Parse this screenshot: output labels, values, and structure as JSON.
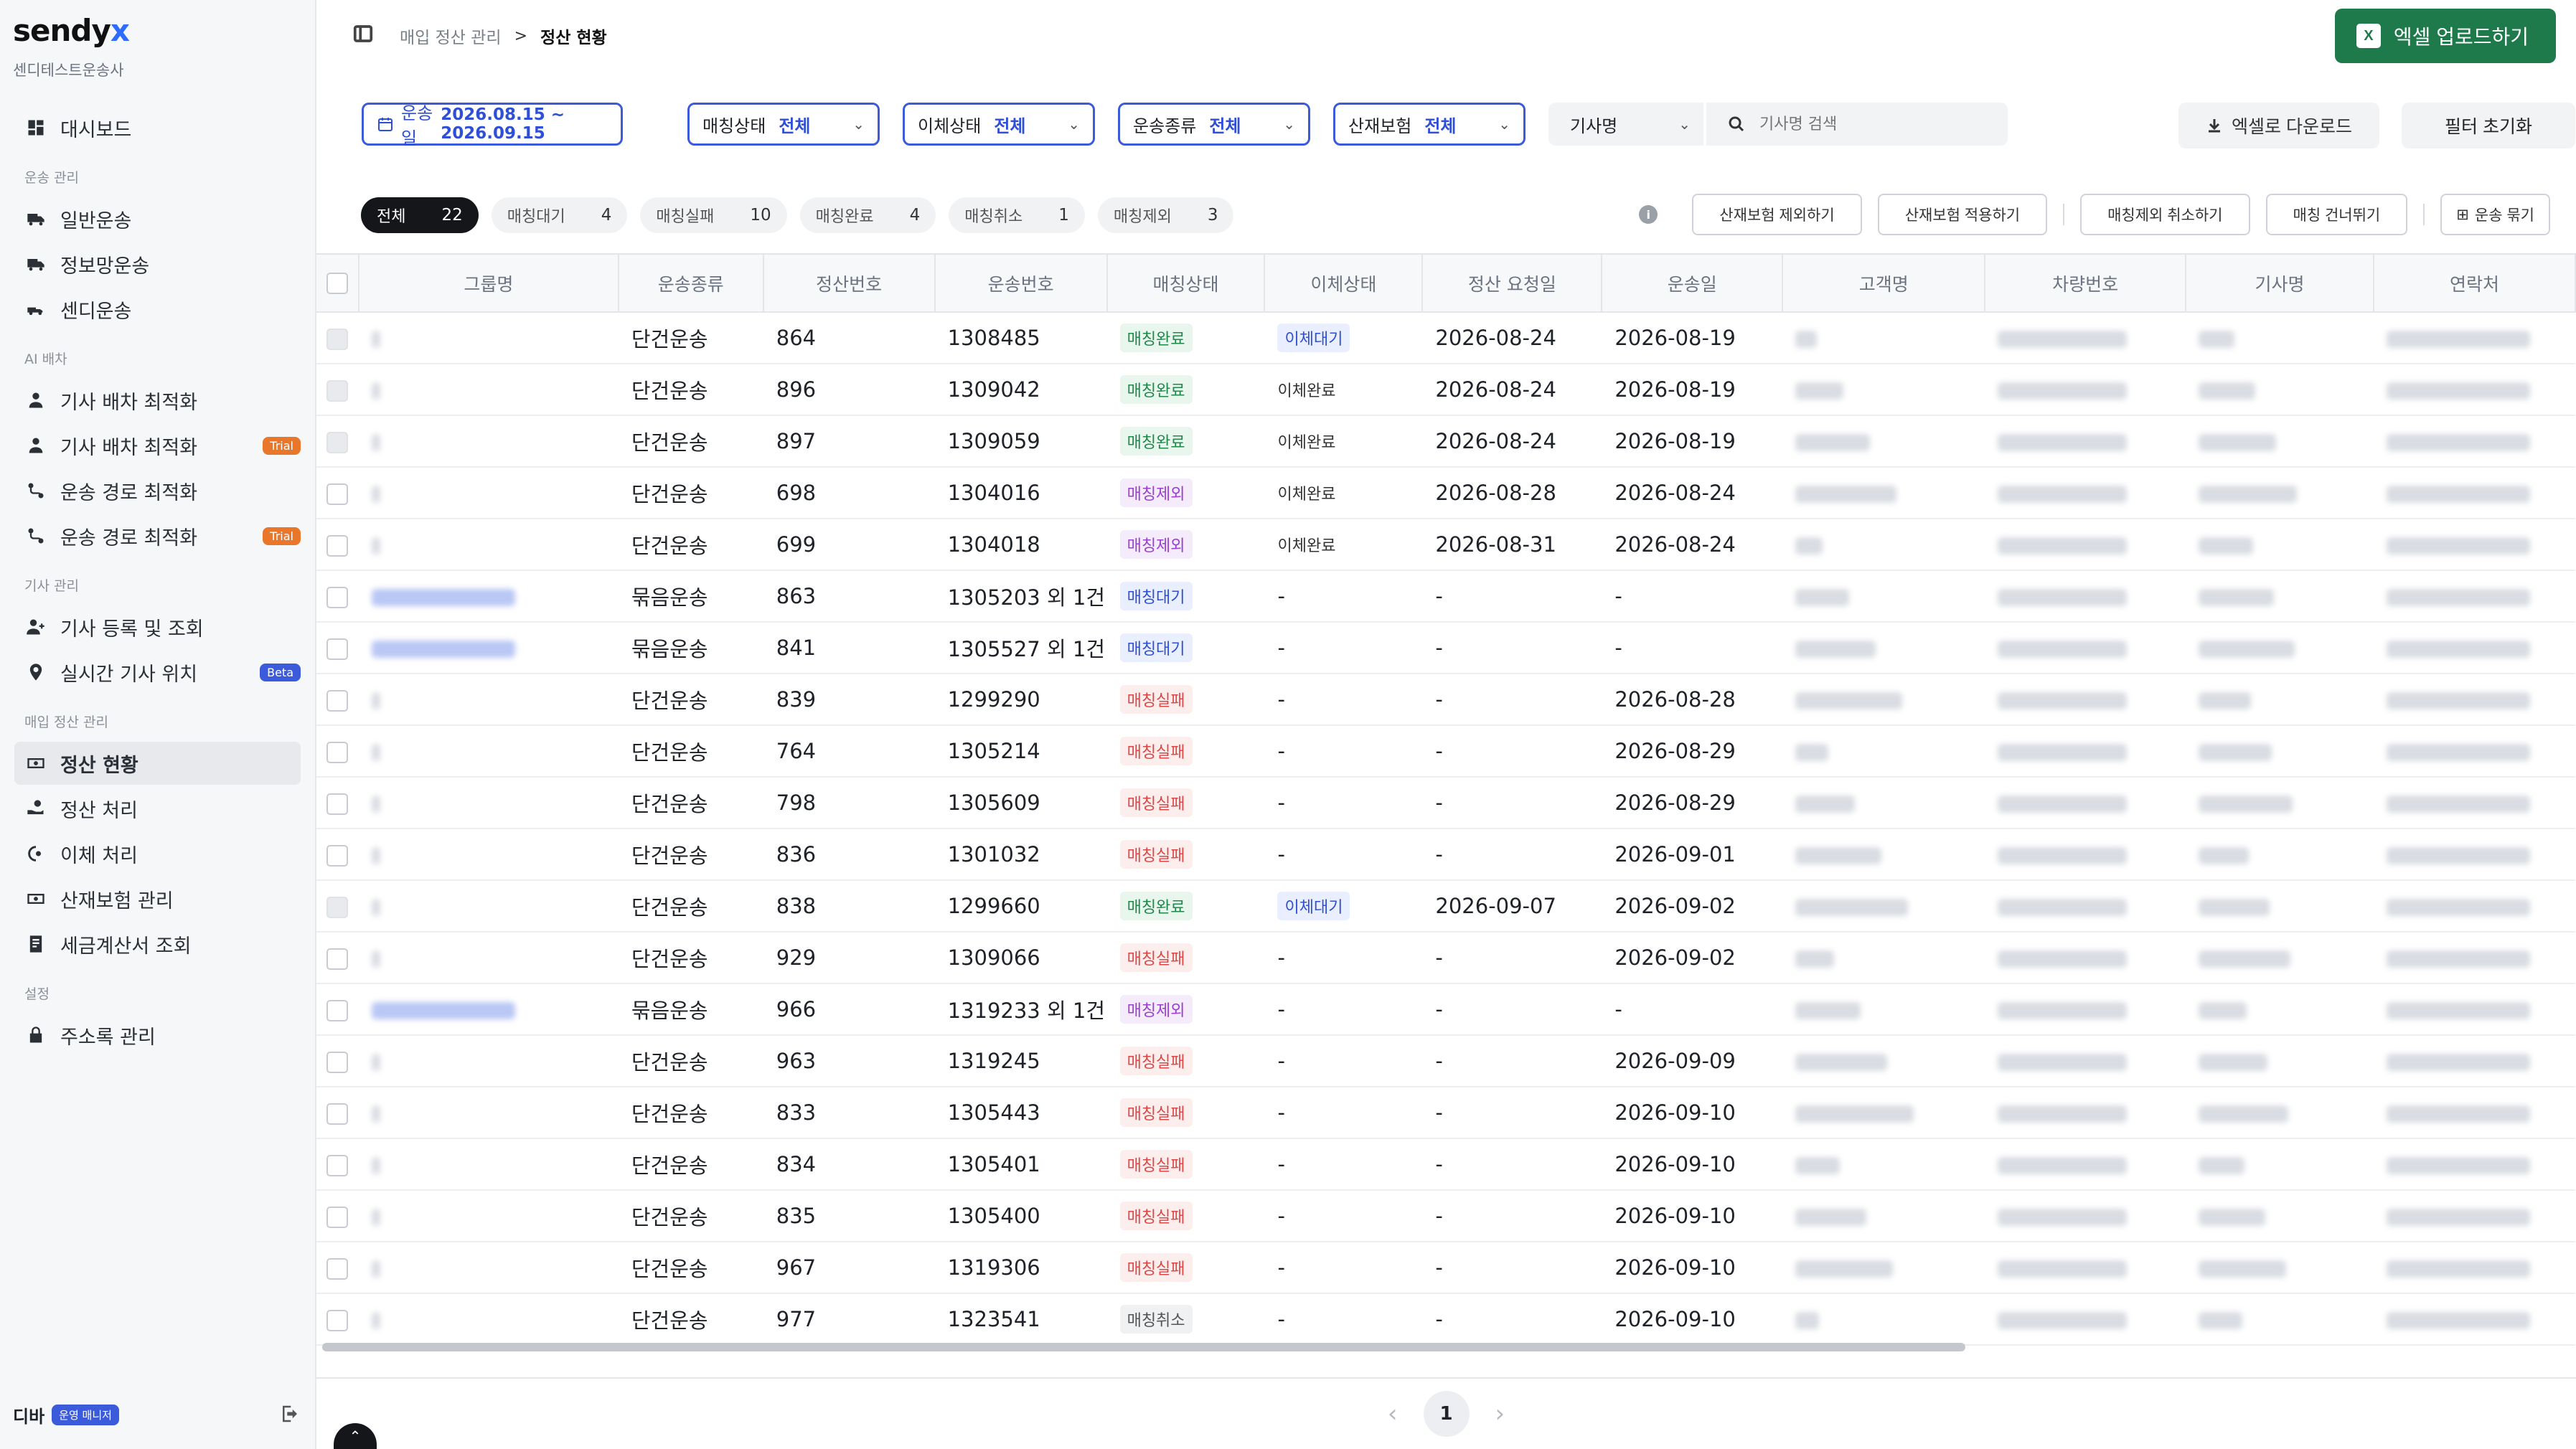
{
  "brand": {
    "name_main": "sendy",
    "name_accent": "x",
    "company": "센디테스트운송사"
  },
  "nav": {
    "dashboard": "대시보드",
    "sec_transport": "운송 관리",
    "general": "일반운송",
    "infonet": "정보망운송",
    "sendy": "센디운송",
    "sec_ai": "AI 배차",
    "driver_opt1": "기사 배차 최적화",
    "driver_opt2": "기사 배차 최적화",
    "route_opt1": "운송 경로 최적화",
    "route_opt2": "운송 경로 최적화",
    "trial": "Trial",
    "sec_driver": "기사 관리",
    "driver_reg": "기사 등록 및 조회",
    "realtime": "실시간 기사 위치",
    "beta": "Beta",
    "sec_settle": "매입 정산 관리",
    "settle_status": "정산 현황",
    "settle_proc": "정산 처리",
    "transfer_proc": "이체 처리",
    "insurance": "산재보험 관리",
    "tax_invoice": "세금계산서 조회",
    "sec_settings": "설정",
    "address": "주소록 관리"
  },
  "user": {
    "name": "디바",
    "role": "운영 매니저"
  },
  "header": {
    "breadcrumb_parent": "매입 정산 관리",
    "breadcrumb_current": "정산 현황",
    "upload_label": "엑셀 업로드하기"
  },
  "filters": {
    "date_label": "운송일",
    "date_value": "2026.08.15 ~ 2026.09.15",
    "matching_label": "매칭상태",
    "matching_value": "전체",
    "transfer_label": "이체상태",
    "transfer_value": "전체",
    "type_label": "운송종류",
    "type_value": "전체",
    "ins_label": "산재보험",
    "ins_value": "전체",
    "driver_select": "기사명",
    "search_placeholder": "기사명 검색",
    "download_label": "엑셀로 다운로드",
    "reset_label": "필터 초기화"
  },
  "tabs": [
    {
      "label": "전체",
      "count": "22"
    },
    {
      "label": "매칭대기",
      "count": "4"
    },
    {
      "label": "매칭실패",
      "count": "10"
    },
    {
      "label": "매칭완료",
      "count": "4"
    },
    {
      "label": "매칭취소",
      "count": "1"
    },
    {
      "label": "매칭제외",
      "count": "3"
    }
  ],
  "actions": {
    "exclude_ins": "산재보험 제외하기",
    "apply_ins": "산재보험 적용하기",
    "cancel_excl": "매칭제외 취소하기",
    "skip": "매칭 건너뛰기",
    "group": "운송 묶기"
  },
  "columns": [
    "그룹명",
    "운송종류",
    "정산번호",
    "운송번호",
    "매칭상태",
    "이체상태",
    "정산 요청일",
    "운송일",
    "고객명",
    "차량번호",
    "기사명",
    "연락처"
  ],
  "rows": [
    {
      "type": "단건운송",
      "settle": "864",
      "order": "1308485",
      "match": "매칭완료",
      "transfer": "이체대기",
      "req": "2026-08-24",
      "date": "2026-08-19"
    },
    {
      "type": "단건운송",
      "settle": "896",
      "order": "1309042",
      "match": "매칭완료",
      "transfer": "이체완료",
      "req": "2026-08-24",
      "date": "2026-08-19"
    },
    {
      "type": "단건운송",
      "settle": "897",
      "order": "1309059",
      "match": "매칭완료",
      "transfer": "이체완료",
      "req": "2026-08-24",
      "date": "2026-08-19"
    },
    {
      "type": "단건운송",
      "settle": "698",
      "order": "1304016",
      "match": "매칭제외",
      "transfer": "이체완료",
      "req": "2026-08-28",
      "date": "2026-08-24"
    },
    {
      "type": "단건운송",
      "settle": "699",
      "order": "1304018",
      "match": "매칭제외",
      "transfer": "이체완료",
      "req": "2026-08-31",
      "date": "2026-08-24"
    },
    {
      "type": "묶음운송",
      "settle": "863",
      "order": "1305203 외 1건",
      "match": "매칭대기",
      "transfer": "-",
      "req": "-",
      "date": "-"
    },
    {
      "type": "묶음운송",
      "settle": "841",
      "order": "1305527 외 1건",
      "match": "매칭대기",
      "transfer": "-",
      "req": "-",
      "date": "-"
    },
    {
      "type": "단건운송",
      "settle": "839",
      "order": "1299290",
      "match": "매칭실패",
      "transfer": "-",
      "req": "-",
      "date": "2026-08-28"
    },
    {
      "type": "단건운송",
      "settle": "764",
      "order": "1305214",
      "match": "매칭실패",
      "transfer": "-",
      "req": "-",
      "date": "2026-08-29"
    },
    {
      "type": "단건운송",
      "settle": "798",
      "order": "1305609",
      "match": "매칭실패",
      "transfer": "-",
      "req": "-",
      "date": "2026-08-29"
    },
    {
      "type": "단건운송",
      "settle": "836",
      "order": "1301032",
      "match": "매칭실패",
      "transfer": "-",
      "req": "-",
      "date": "2026-09-01"
    },
    {
      "type": "단건운송",
      "settle": "838",
      "order": "1299660",
      "match": "매칭완료",
      "transfer": "이체대기",
      "req": "2026-09-07",
      "date": "2026-09-02"
    },
    {
      "type": "단건운송",
      "settle": "929",
      "order": "1309066",
      "match": "매칭실패",
      "transfer": "-",
      "req": "-",
      "date": "2026-09-02"
    },
    {
      "type": "묶음운송",
      "settle": "966",
      "order": "1319233 외 1건",
      "match": "매칭제외",
      "transfer": "-",
      "req": "-",
      "date": "-"
    },
    {
      "type": "단건운송",
      "settle": "963",
      "order": "1319245",
      "match": "매칭실패",
      "transfer": "-",
      "req": "-",
      "date": "2026-09-09"
    },
    {
      "type": "단건운송",
      "settle": "833",
      "order": "1305443",
      "match": "매칭실패",
      "transfer": "-",
      "req": "-",
      "date": "2026-09-10"
    },
    {
      "type": "단건운송",
      "settle": "834",
      "order": "1305401",
      "match": "매칭실패",
      "transfer": "-",
      "req": "-",
      "date": "2026-09-10"
    },
    {
      "type": "단건운송",
      "settle": "835",
      "order": "1305400",
      "match": "매칭실패",
      "transfer": "-",
      "req": "-",
      "date": "2026-09-10"
    },
    {
      "type": "단건운송",
      "settle": "967",
      "order": "1319306",
      "match": "매칭실패",
      "transfer": "-",
      "req": "-",
      "date": "2026-09-10"
    },
    {
      "type": "단건운송",
      "settle": "977",
      "order": "1323541",
      "match": "매칭취소",
      "transfer": "-",
      "req": "-",
      "date": "2026-09-10"
    }
  ],
  "pagination": {
    "current": "1"
  },
  "colors": {
    "accent": "#3b5bdb",
    "upload_green": "#1e7a4a"
  }
}
